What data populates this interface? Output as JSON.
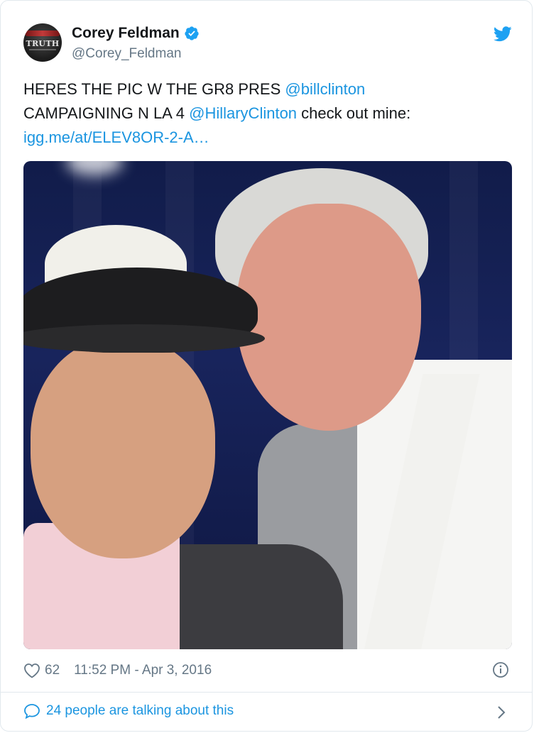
{
  "author": {
    "name": "Corey Feldman",
    "handle": "@Corey_Feldman",
    "avatar_text": "TRUTH",
    "verified": true
  },
  "tweet": {
    "text_parts": [
      {
        "text": "HERES THE PIC W THE GR8 PRES ",
        "type": "text"
      },
      {
        "text": "@billclinton",
        "type": "mention"
      },
      {
        "text": " CAMPAIGNING N LA 4 ",
        "type": "text"
      },
      {
        "text": "@HillaryClinton",
        "type": "mention"
      },
      {
        "text": " check out mine: ",
        "type": "text"
      },
      {
        "text": "igg.me/at/ELEV8OR-2-A…",
        "type": "link"
      }
    ]
  },
  "meta": {
    "likes": "62",
    "timestamp": "11:52 PM - Apr 3, 2016"
  },
  "footer": {
    "talking": "24 people are talking about this"
  },
  "colors": {
    "link": "#1b95e0",
    "text": "#14171a",
    "muted": "#657786",
    "border": "#e1e8ed"
  },
  "icons": {
    "brand": "twitter-bird-icon",
    "verified": "verified-badge-icon",
    "like": "heart-icon",
    "info": "info-icon",
    "reply": "speech-bubble-icon",
    "more": "chevron-right-icon"
  }
}
